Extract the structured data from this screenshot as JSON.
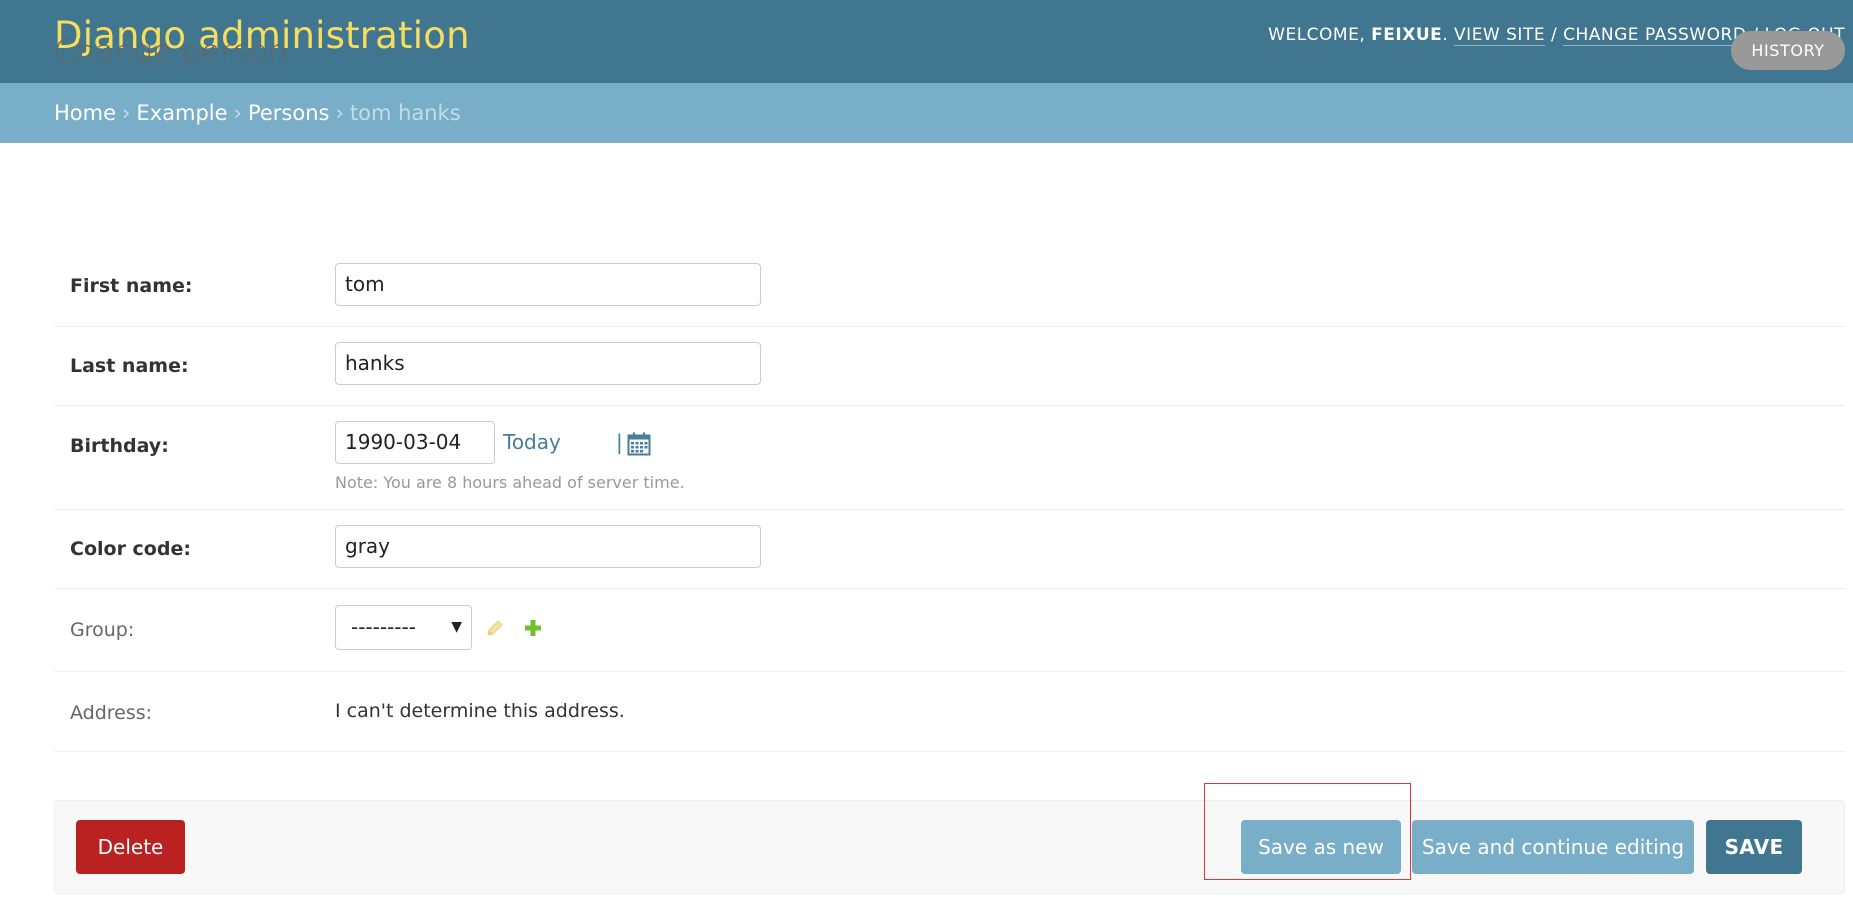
{
  "header": {
    "branding": "Django administration",
    "welcome": "Welcome,",
    "user_name": "feixue",
    "view_site": "View site",
    "change_password": "Change password",
    "log_out": "Log out",
    "separator": "/"
  },
  "breadcrumbs": {
    "items": [
      "Home",
      "Example",
      "Persons"
    ],
    "current": "tom hanks",
    "separator": "›"
  },
  "page": {
    "title": "Change person",
    "history_label": "History"
  },
  "form": {
    "first_name": {
      "label": "First name:",
      "value": "tom"
    },
    "last_name": {
      "label": "Last name:",
      "value": "hanks"
    },
    "birthday": {
      "label": "Birthday:",
      "value": "1990-03-04",
      "today_label": "Today",
      "pipe": "|",
      "help": "Note: You are 8 hours ahead of server time."
    },
    "color_code": {
      "label": "Color code:",
      "value": "gray"
    },
    "group": {
      "label": "Group:",
      "selected": "---------"
    },
    "address": {
      "label": "Address:",
      "value": "I can't determine this address."
    }
  },
  "actions": {
    "delete_label": "Delete",
    "save_as_new_label": "Save as new",
    "save_continue_label": "Save and continue editing",
    "save_label": "SAVE"
  },
  "colors": {
    "header_bg": "#417690",
    "branding": "#f5dd5d",
    "breadcrumbs_bg": "#79aec8",
    "delete_bg": "#ba2121",
    "highlight": "#e0353a"
  }
}
